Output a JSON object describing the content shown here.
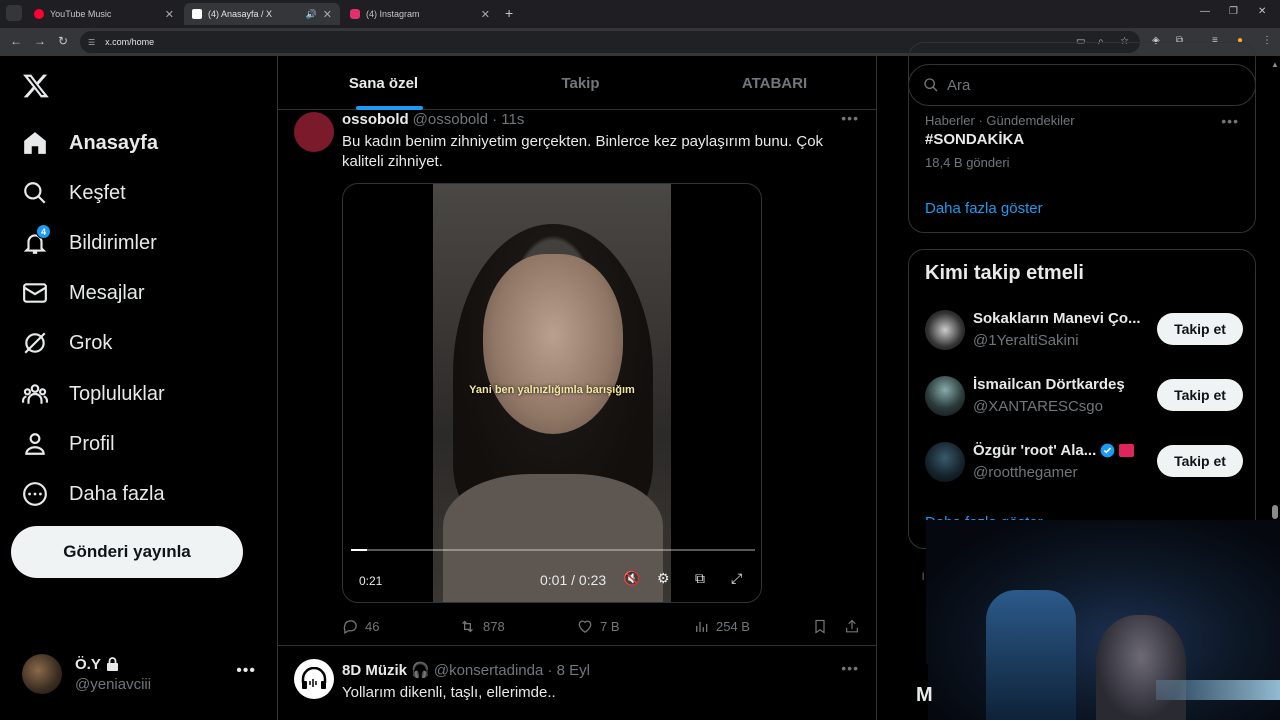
{
  "browser": {
    "tabs": [
      {
        "title": "YouTube Music",
        "favicon_color": "#ff0033"
      },
      {
        "title": "(4) Anasayfa / X",
        "favicon_color": "#ffffff"
      },
      {
        "title": "(4) Instagram",
        "favicon_color": "#e1306c"
      }
    ],
    "url": "x.com/home"
  },
  "sidebar": {
    "items": [
      {
        "label": "Anasayfa",
        "icon": "home-icon"
      },
      {
        "label": "Keşfet",
        "icon": "search-icon"
      },
      {
        "label": "Bildirimler",
        "icon": "bell-icon",
        "badge": "4"
      },
      {
        "label": "Mesajlar",
        "icon": "mail-icon"
      },
      {
        "label": "Grok",
        "icon": "grok-icon"
      },
      {
        "label": "Topluluklar",
        "icon": "communities-icon"
      },
      {
        "label": "Profil",
        "icon": "profile-icon"
      },
      {
        "label": "Daha fazla",
        "icon": "more-circle-icon"
      }
    ],
    "post_button": "Gönderi yayınla",
    "profile": {
      "name": "Ö.Y",
      "handle": "@yeniavciii"
    }
  },
  "timeline": {
    "tabs": [
      "Sana özel",
      "Takip",
      "ATABARI"
    ],
    "tweets": [
      {
        "name": "ossobold",
        "meta": "@ossobold · 11s",
        "text": "Bu kadın benim zihniyetim gerçekten. Binlerce kez paylaşırım bunu. Çok kaliteli zihniyet.",
        "video": {
          "subtitle": "Yani ben yalnızlığımla barışığım",
          "time": "0:01 / 0:23",
          "left_label": "0:21",
          "progress": 0.04
        },
        "replies": "46",
        "reposts": "878",
        "likes": "7 B",
        "views": "254 B"
      },
      {
        "name": "8D Müzik 🎧",
        "meta": "@konsertadinda · 8 Eyl",
        "text": "Yollarım dikenli, taşlı, ellerimde.."
      }
    ]
  },
  "right": {
    "search_placeholder": "Ara",
    "trend": {
      "meta": "Haberler · Gündemdekiler",
      "tag": "#SONDAKİKA",
      "count": "18,4 B gönderi"
    },
    "show_more": "Daha fazla göster",
    "who_to_follow": {
      "title": "Kimi takip etmeli",
      "follow_label": "Takip et",
      "users": [
        {
          "name": "Sokakların Manevi Ço...",
          "handle": "@1YeraltiSakini"
        },
        {
          "name": "İsmailcan Dörtkardeş",
          "handle": "@XANTARESCsgo"
        },
        {
          "name": "Özgür 'root' Ala...",
          "handle": "@rootthegamer"
        }
      ],
      "show_more_partial": "Daha fazla göster"
    }
  }
}
